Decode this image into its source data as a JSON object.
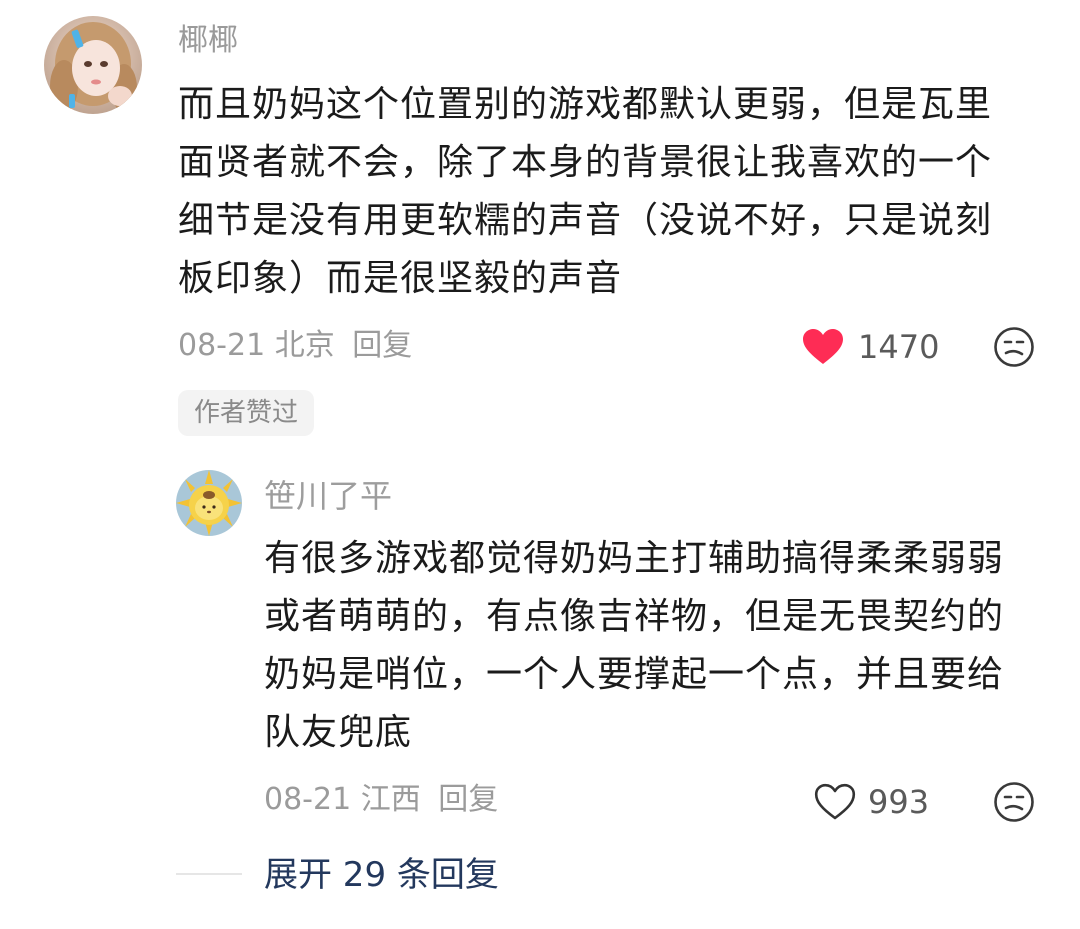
{
  "comment": {
    "username": "椰椰",
    "body_lines": [
      "而且奶妈这个位置别的游戏都默认更弱，但是瓦里",
      "面贤者就不会，除了本身的背景很让我喜欢的一个",
      "细节是没有用更软糯的声音（没说不好，只是说刻",
      "板印象）而是很坚毅的声音"
    ],
    "date_location": "08-21 北京",
    "reply_label": "回复",
    "like_count": "1470",
    "liked": true,
    "author_liked_badge": "作者赞过",
    "colors": {
      "heart": "#fe2c55",
      "meta": "#9b9b9b"
    }
  },
  "reply": {
    "username": "笹川了平",
    "body_lines": [
      "有很多游戏都觉得奶妈主打辅助搞得柔柔弱弱",
      "或者萌萌的，有点像吉祥物，但是无畏契约的",
      "奶妈是哨位，一个人要撑起一个点，并且要给",
      "队友兜底"
    ],
    "date_location": "08-21 江西",
    "reply_label": "回复",
    "like_count": "993",
    "liked": false
  },
  "expand": {
    "label": "展开 29 条回复",
    "color": "#23385d"
  },
  "icons": {
    "heart_filled": "heart-filled-icon",
    "heart_outline": "heart-outline-icon",
    "dislike": "dislike-face-icon"
  }
}
